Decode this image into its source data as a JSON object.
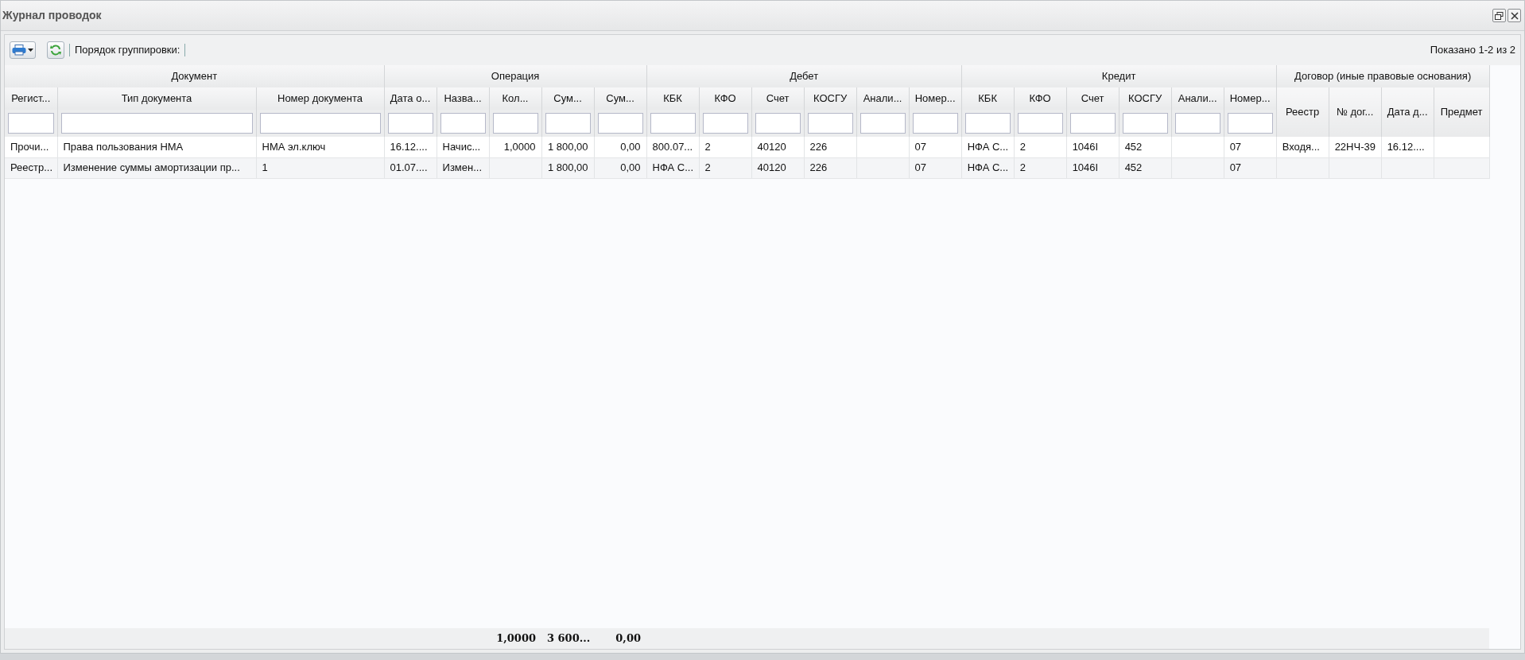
{
  "window": {
    "title": "Журнал проводок"
  },
  "toolbar": {
    "grouping_label": "Порядок группировки:",
    "paging": "Показано 1-2 из 2"
  },
  "column_groups": [
    {
      "label": "Документ",
      "columns": [
        {
          "label": "Регист...",
          "kind": "text",
          "filter": true
        },
        {
          "label": "Тип документа",
          "kind": "text",
          "filter": true
        },
        {
          "label": "Номер документа",
          "kind": "text",
          "filter": true
        }
      ]
    },
    {
      "label": "Операция",
      "columns": [
        {
          "label": "Дата о...",
          "kind": "text",
          "filter": true
        },
        {
          "label": "Назва...",
          "kind": "text",
          "filter": true
        },
        {
          "label": "Кол...",
          "kind": "number",
          "filter": true,
          "total": "1,0000"
        },
        {
          "label": "Сум...",
          "kind": "number",
          "filter": true,
          "total": "3 600..."
        },
        {
          "label": "Сум...",
          "kind": "number",
          "filter": true,
          "total": "0,00"
        }
      ]
    },
    {
      "label": "Дебет",
      "columns": [
        {
          "label": "КБК",
          "kind": "text",
          "filter": true
        },
        {
          "label": "КФО",
          "kind": "text",
          "filter": true
        },
        {
          "label": "Счет",
          "kind": "text",
          "filter": true
        },
        {
          "label": "КОСГУ",
          "kind": "text",
          "filter": true
        },
        {
          "label": "Анали...",
          "kind": "text",
          "filter": true
        },
        {
          "label": "Номер...",
          "kind": "text",
          "filter": true
        }
      ]
    },
    {
      "label": "Кредит",
      "columns": [
        {
          "label": "КБК",
          "kind": "text",
          "filter": true
        },
        {
          "label": "КФО",
          "kind": "text",
          "filter": true
        },
        {
          "label": "Счет",
          "kind": "text",
          "filter": true
        },
        {
          "label": "КОСГУ",
          "kind": "text",
          "filter": true
        },
        {
          "label": "Анали...",
          "kind": "text",
          "filter": true
        },
        {
          "label": "Номер...",
          "kind": "text",
          "filter": true
        }
      ]
    },
    {
      "label": "Договор (иные правовые основания)",
      "columns": [
        {
          "label": "Реестр",
          "kind": "text",
          "filter": false
        },
        {
          "label": "№ дог...",
          "kind": "text",
          "filter": false
        },
        {
          "label": "Дата д...",
          "kind": "text",
          "filter": false
        },
        {
          "label": "Предмет",
          "kind": "text",
          "filter": false
        }
      ]
    }
  ],
  "rows": [
    {
      "cells": [
        {
          "text": "Прочи..."
        },
        {
          "text": "Права пользования НМА"
        },
        {
          "text": "НМА эл.ключ"
        },
        {
          "text": "16.12...."
        },
        {
          "text": "Начис..."
        },
        {
          "text": "1,0000"
        },
        {
          "text": "1 800,00"
        },
        {
          "text": "0,00"
        },
        {
          "text": "800.07..."
        },
        {
          "text": "2"
        },
        {
          "text": "40120"
        },
        {
          "text": "226"
        },
        {},
        {
          "text": "07"
        },
        {
          "text": "НФА С..."
        },
        {
          "text": "2"
        },
        {
          "text": "1046I"
        },
        {
          "text": "452"
        },
        {},
        {
          "text": "07"
        },
        {
          "text": "Входя..."
        },
        {
          "text": "22НЧ-39"
        },
        {
          "text": "16.12...."
        },
        {}
      ]
    },
    {
      "cells": [
        {
          "text": "Реестр..."
        },
        {
          "text": "Изменение суммы амортизации пр..."
        },
        {
          "text": "1"
        },
        {
          "text": "01.07...."
        },
        {
          "text": "Измен..."
        },
        {},
        {
          "text": "1 800,00"
        },
        {
          "text": "0,00"
        },
        {
          "text": "НФА С..."
        },
        {
          "text": "2"
        },
        {
          "text": "40120"
        },
        {
          "text": "226"
        },
        {},
        {
          "text": "07"
        },
        {
          "text": "НФА С..."
        },
        {
          "text": "2"
        },
        {
          "text": "1046I"
        },
        {
          "text": "452"
        },
        {},
        {
          "text": "07"
        },
        {},
        {},
        {},
        {}
      ]
    }
  ]
}
